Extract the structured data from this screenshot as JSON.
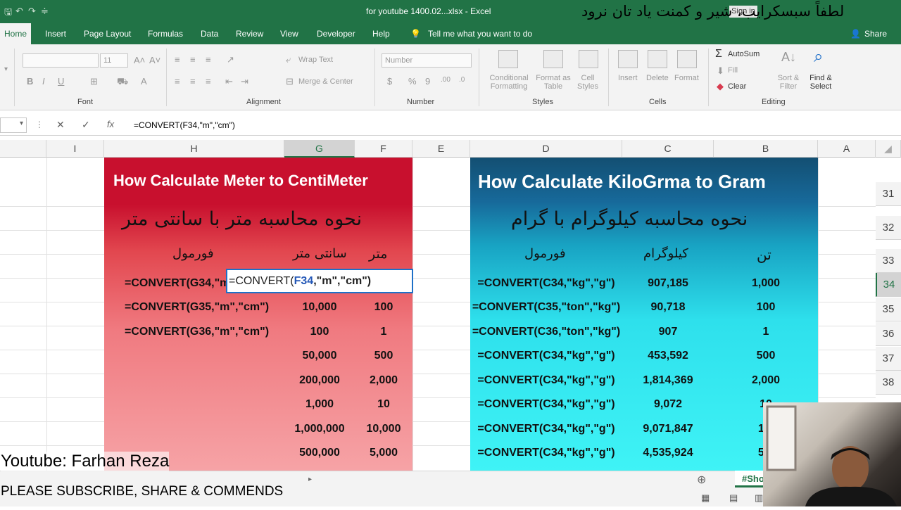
{
  "window": {
    "title": "for youtube 1400.02...xlsx  -  Excel",
    "signin_label": "Sign in",
    "overlay_persian": "لطفاً سبسکرایب، شیر و کمنت یاد تان نرود"
  },
  "tabs": [
    "Home",
    "Insert",
    "Page Layout",
    "Formulas",
    "Data",
    "Review",
    "View",
    "Developer",
    "Help"
  ],
  "tell_me": "Tell me what you want to do",
  "share_label": "Share",
  "ribbon": {
    "font_label": "Font",
    "font_size": "11",
    "alignment_label": "Alignment",
    "wrap_text": "Wrap Text",
    "merge_center": "Merge & Center",
    "number_label": "Number",
    "number_format": "Number",
    "styles_label": "Styles",
    "conditional_formatting": "Conditional Formatting",
    "format_as_table": "Format as Table",
    "cell_styles": "Cell Styles",
    "cells_label": "Cells",
    "insert": "Insert",
    "delete": "Delete",
    "format": "Format",
    "editing_label": "Editing",
    "autosum": "AutoSum",
    "fill": "Fill",
    "clear": "Clear",
    "sort_filter": "Sort & Filter",
    "find_select": "Find & Select"
  },
  "formula_bar": {
    "formula": "=CONVERT(F34,\"m\",\"cm\")"
  },
  "columns": [
    "I",
    "H",
    "G",
    "F",
    "E",
    "D",
    "C",
    "B",
    "A"
  ],
  "rows": [
    "31",
    "32",
    "33",
    "34",
    "35",
    "36",
    "37",
    "38"
  ],
  "left_panel": {
    "title": "How Calculate Meter to CentiMeter",
    "subtitle_fa": "نحوه محاسبه متر با سانتی متر",
    "header_formula": "فورمول",
    "header_cm": "سانتی متر",
    "header_m": "متر",
    "edit_prefix": "=CONVERT(",
    "edit_ref": "F34",
    "edit_suffix": ",\"m\",\"cm\")",
    "first_formula_partial": "=CONVERT(G34,\"m",
    "formulas": [
      "=CONVERT(G35,\"m\",\"cm\")",
      "=CONVERT(G36,\"m\",\"cm\")"
    ],
    "cm_values": [
      "10,000",
      "100",
      "50,000",
      "200,000",
      "1,000",
      "1,000,000",
      "500,000"
    ],
    "m_values": [
      "100",
      "1",
      "500",
      "2,000",
      "10",
      "10,000",
      "5,000"
    ]
  },
  "right_panel": {
    "title": "How Calculate KiloGrma to Gram",
    "subtitle_fa": "نحوه محاسبه کیلوگرام با گرام",
    "header_formula": "فورمول",
    "header_kg": "کیلوگرام",
    "header_ton": "تن",
    "formulas": [
      "=CONVERT(C34,\"kg\",\"g\")",
      "=CONVERT(C35,\"ton\",\"kg\")",
      "=CONVERT(C36,\"ton\",\"kg\")",
      "=CONVERT(C34,\"kg\",\"g\")",
      "=CONVERT(C34,\"kg\",\"g\")",
      "=CONVERT(C34,\"kg\",\"g\")",
      "=CONVERT(C34,\"kg\",\"g\")",
      "=CONVERT(C34,\"kg\",\"g\")"
    ],
    "kg_values": [
      "907,185",
      "90,718",
      "907",
      "453,592",
      "1,814,369",
      "9,072",
      "9,071,847",
      "4,535,924"
    ],
    "ton_values": [
      "1,000",
      "100",
      "1",
      "500",
      "2,000",
      "10",
      "10,",
      "5,0"
    ]
  },
  "overlays": {
    "youtube_credit": "Youtube: Farhan Reza",
    "subscribe_text": "PLEASE SUBSCRIBE, SHARE & COMMENDS"
  },
  "sheet_tab": "#Sho"
}
